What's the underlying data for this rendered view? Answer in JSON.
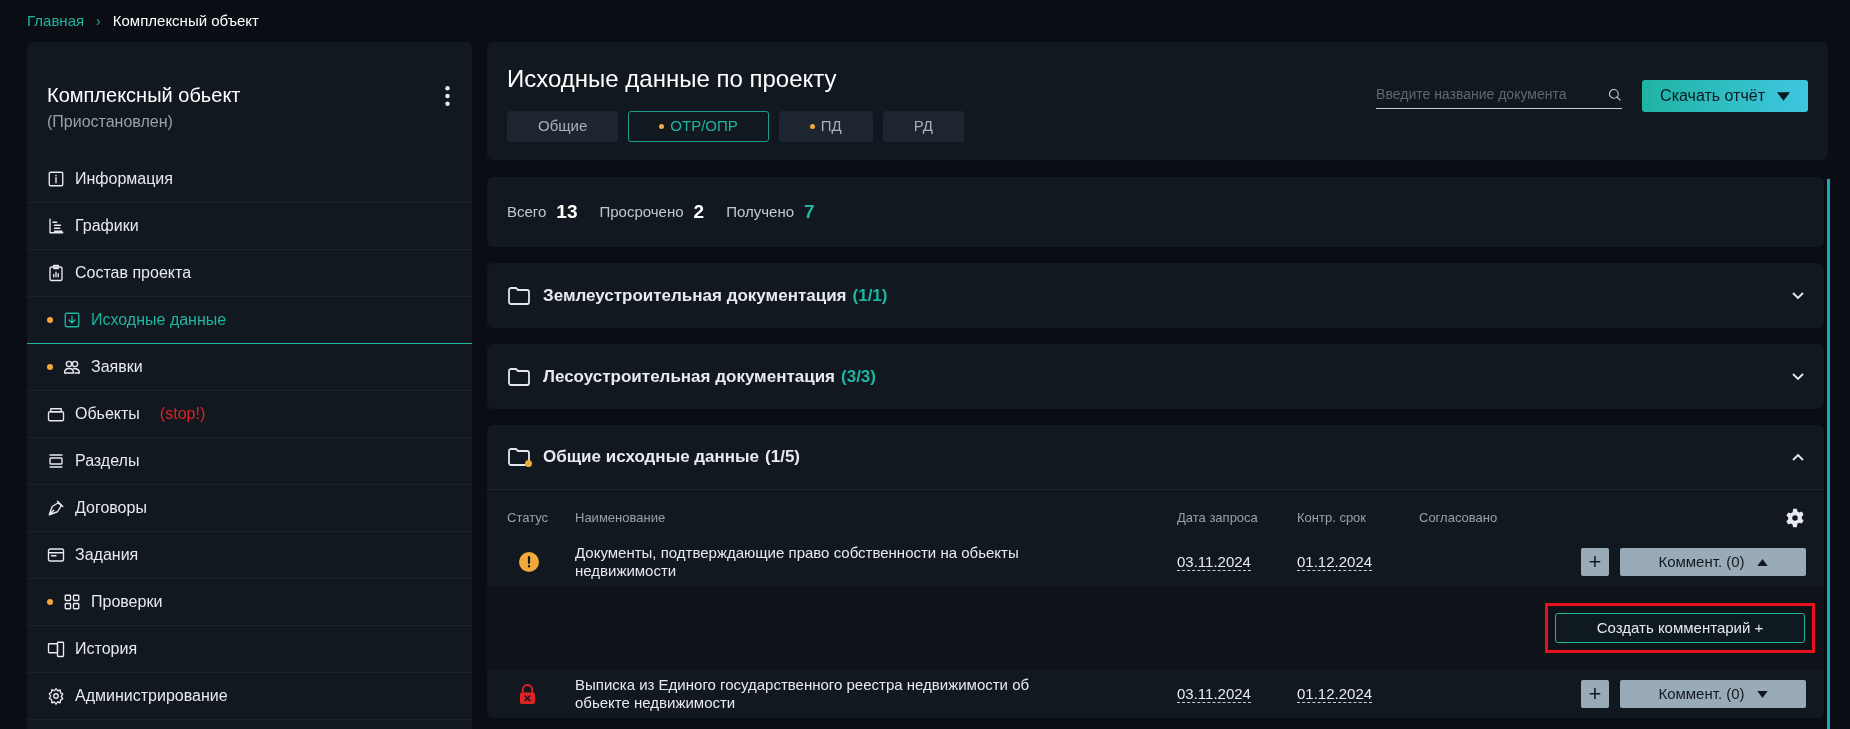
{
  "breadcrumbs": [
    {
      "label": "Главная",
      "link": true
    },
    {
      "label": "Комплексный объект",
      "link": false,
      "separator": "›"
    }
  ],
  "sidebar": {
    "title": "Комплексный обьект",
    "status": "(Приостановлен)",
    "items": [
      {
        "label": "Информация",
        "dot": false,
        "selected": false
      },
      {
        "label": "Графики",
        "dot": false,
        "selected": false
      },
      {
        "label": "Состав проекта",
        "dot": false,
        "selected": false
      },
      {
        "label": "Исходные данные",
        "dot": true,
        "selected": true
      },
      {
        "label": "Заявки",
        "dot": true,
        "selected": false
      },
      {
        "label": "Обьекты",
        "dot": false,
        "selected": false,
        "tag": "(stop!)"
      },
      {
        "label": "Разделы",
        "dot": false,
        "selected": false
      },
      {
        "label": "Договоры",
        "dot": false,
        "selected": false
      },
      {
        "label": "Задания",
        "dot": false,
        "selected": false
      },
      {
        "label": "Проверки",
        "dot": true,
        "selected": false
      },
      {
        "label": "История",
        "dot": false,
        "selected": false
      },
      {
        "label": "Администрирование",
        "dot": false,
        "selected": false
      }
    ]
  },
  "header": {
    "title": "Исходные данные по проекту",
    "tabs": [
      {
        "label": "Общие",
        "dot": false,
        "selected": false
      },
      {
        "label": "ОТР/ОПР",
        "dot": true,
        "selected": true
      },
      {
        "label": "ПД",
        "dot": true,
        "selected": false
      },
      {
        "label": "РД",
        "dot": false,
        "selected": false
      }
    ],
    "search": {
      "placeholder": "Введите название документа"
    },
    "download_button": "Скачать отчёт"
  },
  "stats": [
    {
      "label": "Всего",
      "value": "13",
      "highlight": false
    },
    {
      "label": "Просрочено",
      "value": "2",
      "highlight": false
    },
    {
      "label": "Получено",
      "value": "7",
      "highlight": true
    }
  ],
  "sections": [
    {
      "title": "Землеустроительная документация",
      "count": "(1/1)",
      "complete": true,
      "expanded": false,
      "dot": false
    },
    {
      "title": "Лесоустроительная документация",
      "count": "(3/3)",
      "complete": true,
      "expanded": false,
      "dot": false
    },
    {
      "title": "Общие исходные данные",
      "count": "(1/5)",
      "complete": false,
      "expanded": true,
      "dot": true,
      "columns": [
        "Статус",
        "Наименование",
        "Дата запроса",
        "Контр. срок",
        "Согласовано"
      ],
      "rows": [
        {
          "kind": "warning",
          "name": "Документы, подтверждающие право собственности на обьекты недвижимости",
          "request_date": "03.11.2024",
          "deadline": "01.12.2024",
          "add": "+",
          "comment": "Коммент. (0)",
          "expanded": true,
          "create_comment": "Создать комментарий +",
          "highlighted": true
        },
        {
          "kind": "locked",
          "name": "Выписка из Единого государственного реестра недвижимости об обьекте недвижимости",
          "request_date": "03.11.2024",
          "deadline": "01.12.2024",
          "add": "+",
          "comment": "Коммент. (0)",
          "expanded": false
        }
      ]
    }
  ]
}
